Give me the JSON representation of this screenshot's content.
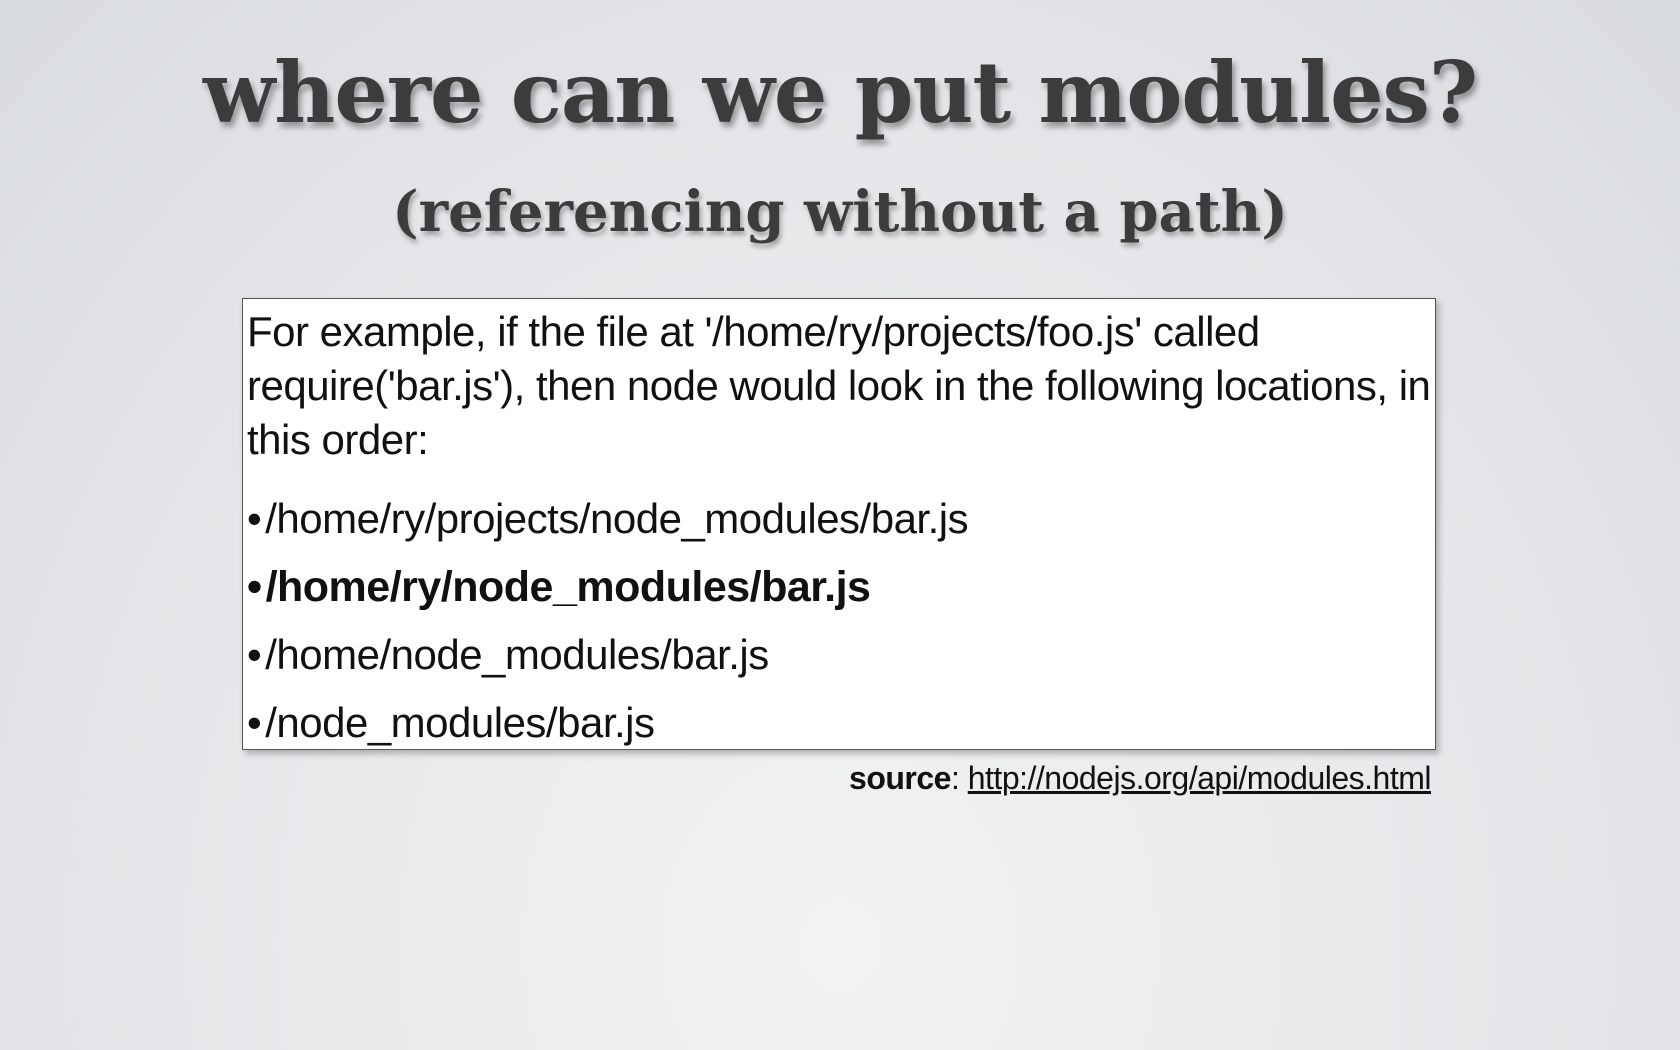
{
  "slide": {
    "title": "where can we put modules?",
    "subtitle": "(referencing without a path)",
    "intro_text": "For example, if the file at '/home/ry/projects/foo.js' called require('bar.js'), then node would look in the following locations, in this order:",
    "bullet_glyph": "•",
    "paths": [
      {
        "text": "/home/ry/projects/node_modules/bar.js",
        "emphasized": false
      },
      {
        "text": "/home/ry/node_modules/bar.js",
        "emphasized": true
      },
      {
        "text": "/home/node_modules/bar.js",
        "emphasized": false
      },
      {
        "text": "/node_modules/bar.js",
        "emphasized": false
      }
    ],
    "source_label": "source",
    "source_separator": ": ",
    "source_url": "http://nodejs.org/api/modules.html"
  },
  "colors": {
    "title_text": "#3c3c3c",
    "box_background": "#ffffff",
    "body_text": "#111111"
  }
}
